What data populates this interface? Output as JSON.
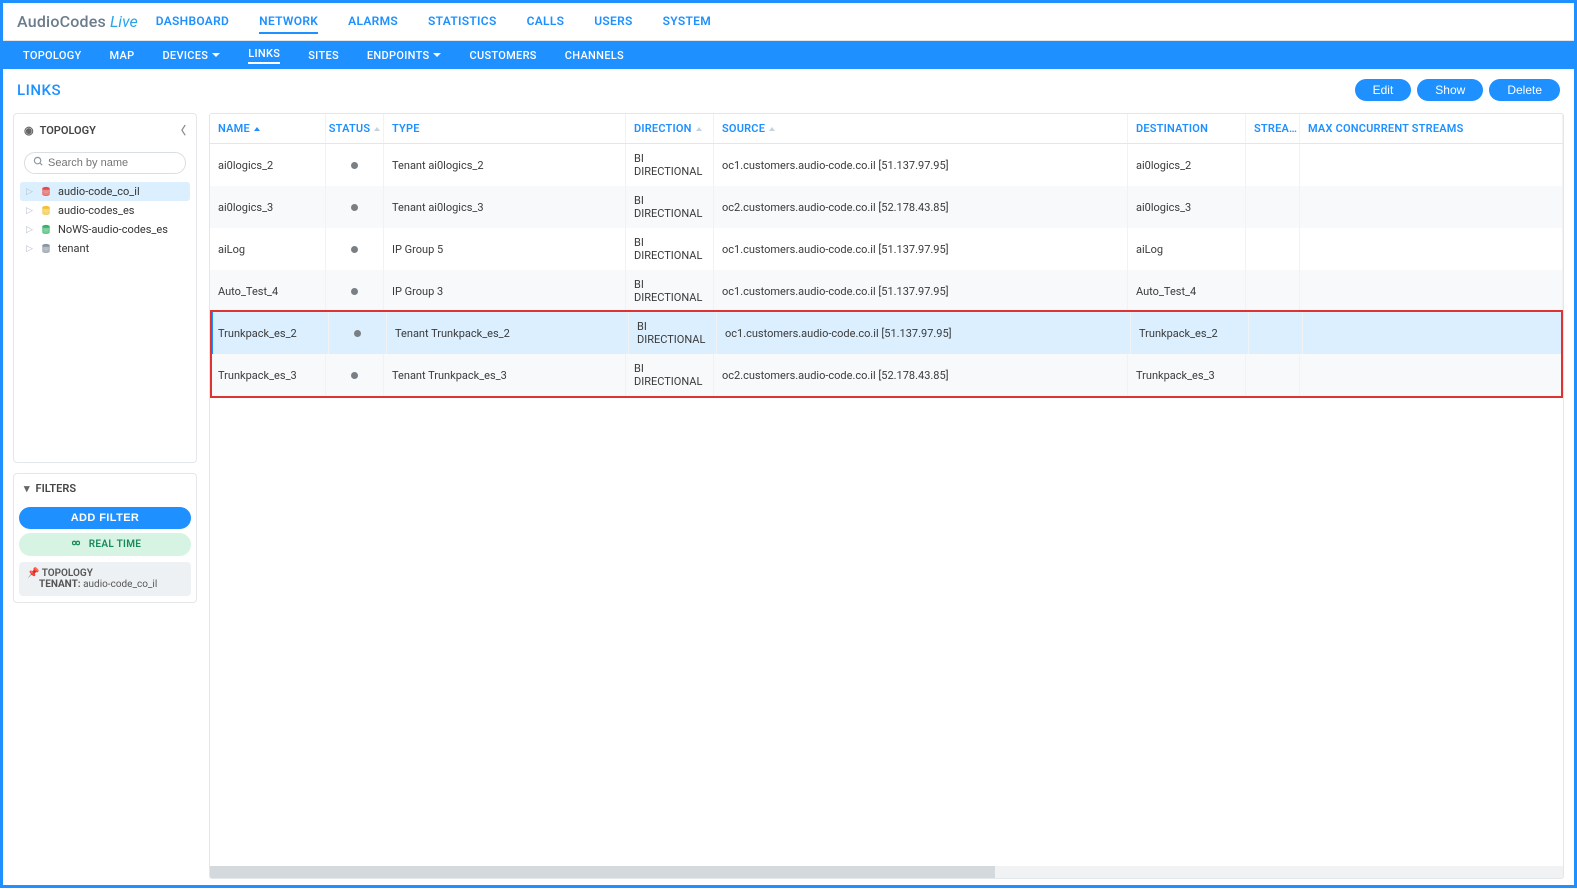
{
  "brand": {
    "main": "AudioCodes",
    "sub": "Live"
  },
  "mainNav": [
    {
      "label": "DASHBOARD",
      "active": false
    },
    {
      "label": "NETWORK",
      "active": true
    },
    {
      "label": "ALARMS",
      "active": false
    },
    {
      "label": "STATISTICS",
      "active": false
    },
    {
      "label": "CALLS",
      "active": false
    },
    {
      "label": "USERS",
      "active": false
    },
    {
      "label": "SYSTEM",
      "active": false
    }
  ],
  "subNav": [
    {
      "label": "TOPOLOGY",
      "dropdown": false,
      "active": false
    },
    {
      "label": "MAP",
      "dropdown": false,
      "active": false
    },
    {
      "label": "DEVICES",
      "dropdown": true,
      "active": false
    },
    {
      "label": "LINKS",
      "dropdown": false,
      "active": true
    },
    {
      "label": "SITES",
      "dropdown": false,
      "active": false
    },
    {
      "label": "ENDPOINTS",
      "dropdown": true,
      "active": false
    },
    {
      "label": "CUSTOMERS",
      "dropdown": false,
      "active": false
    },
    {
      "label": "CHANNELS",
      "dropdown": false,
      "active": false
    }
  ],
  "pageTitle": "LINKS",
  "actions": {
    "edit": "Edit",
    "show": "Show",
    "delete": "Delete"
  },
  "sidebar": {
    "topologyTitle": "TOPOLOGY",
    "searchPlaceholder": "Search by name",
    "tree": [
      {
        "label": "audio-code_co_il",
        "color": "#e24d4d",
        "selected": true
      },
      {
        "label": "audio-codes_es",
        "color": "#f2c233",
        "selected": false
      },
      {
        "label": "NoWS-audio-codes_es",
        "color": "#38b36a",
        "selected": false
      },
      {
        "label": "tenant",
        "color": "#8a97a3",
        "selected": false
      }
    ],
    "filtersTitle": "FILTERS",
    "addFilter": "ADD FILTER",
    "realtime": "REAL TIME",
    "topologyPill": {
      "line1": "TOPOLOGY",
      "line2a": "TENANT:",
      "line2b": " audio-code_co_il"
    }
  },
  "columns": {
    "name": "NAME",
    "status": "STATUS",
    "type": "TYPE",
    "direction": "DIRECTION",
    "source": "SOURCE",
    "destination": "DESTINATION",
    "streams": "STREA…",
    "maxStreams": "MAX CONCURRENT STREAMS"
  },
  "rows": [
    {
      "name": "ai0logics_2",
      "type": "Tenant ai0logics_2",
      "direction": "BI DIRECTIONAL",
      "source": "oc1.customers.audio-code.co.il [51.137.97.95]",
      "destination": "ai0logics_2",
      "selected": false
    },
    {
      "name": "ai0logics_3",
      "type": "Tenant ai0logics_3",
      "direction": "BI DIRECTIONAL",
      "source": "oc2.customers.audio-code.co.il [52.178.43.85]",
      "destination": "ai0logics_3",
      "selected": false
    },
    {
      "name": "aiLog",
      "type": "IP Group 5",
      "direction": "BI DIRECTIONAL",
      "source": "oc1.customers.audio-code.co.il [51.137.97.95]",
      "destination": "aiLog",
      "selected": false
    },
    {
      "name": "Auto_Test_4",
      "type": "IP Group 3",
      "direction": "BI DIRECTIONAL",
      "source": "oc1.customers.audio-code.co.il [51.137.97.95]",
      "destination": "Auto_Test_4",
      "selected": false
    },
    {
      "name": "Trunkpack_es_2",
      "type": "Tenant Trunkpack_es_2",
      "direction": "BI DIRECTIONAL",
      "source": "oc1.customers.audio-code.co.il [51.137.97.95]",
      "destination": "Trunkpack_es_2",
      "selected": true
    },
    {
      "name": "Trunkpack_es_3",
      "type": "Tenant Trunkpack_es_3",
      "direction": "BI DIRECTIONAL",
      "source": "oc2.customers.audio-code.co.il [52.178.43.85]",
      "destination": "Trunkpack_es_3",
      "selected": false
    }
  ],
  "highlightedRows": [
    4,
    5
  ]
}
